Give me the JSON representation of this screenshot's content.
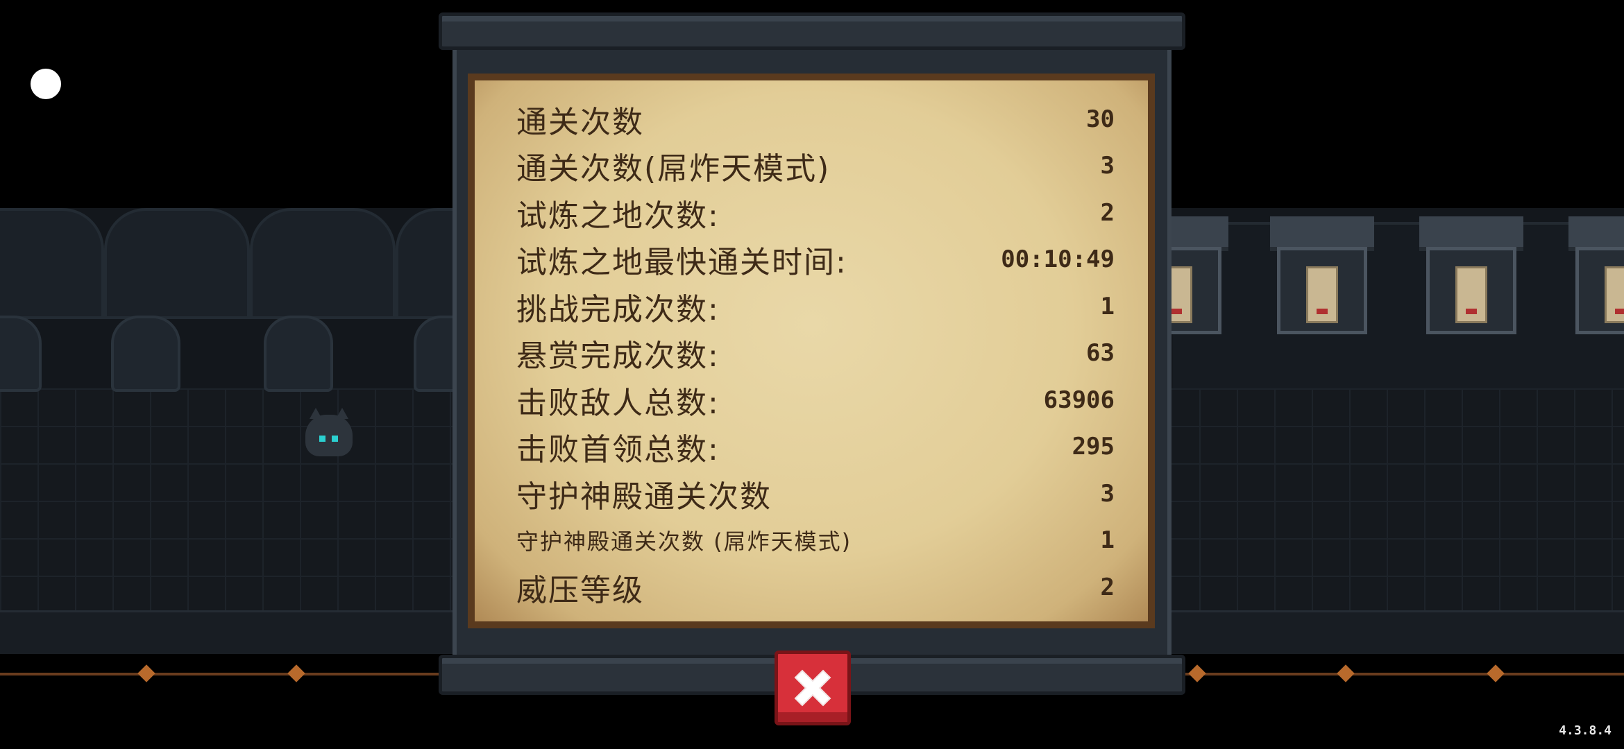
{
  "stats_panel": {
    "rows": [
      {
        "label": "通关次数",
        "value": "30",
        "small": false
      },
      {
        "label": "通关次数(屌炸天模式)",
        "value": "3",
        "small": false
      },
      {
        "label": "试炼之地次数:",
        "value": "2",
        "small": false
      },
      {
        "label": "试炼之地最快通关时间:",
        "value": "00:10:49",
        "small": false
      },
      {
        "label": "挑战完成次数:",
        "value": "1",
        "small": false
      },
      {
        "label": "悬赏完成次数:",
        "value": "63",
        "small": false
      },
      {
        "label": "击败敌人总数:",
        "value": "63906",
        "small": false
      },
      {
        "label": "击败首领总数:",
        "value": "295",
        "small": false
      },
      {
        "label": "守护神殿通关次数",
        "value": "3",
        "small": false
      },
      {
        "label": "守护神殿通关次数 (屌炸天模式)",
        "value": "1",
        "small": true
      },
      {
        "label": "威压等级",
        "value": "2",
        "small": false
      }
    ]
  },
  "close_button": {
    "icon": "close-icon",
    "color": "#d7303a"
  },
  "version": "4.3.8.4"
}
